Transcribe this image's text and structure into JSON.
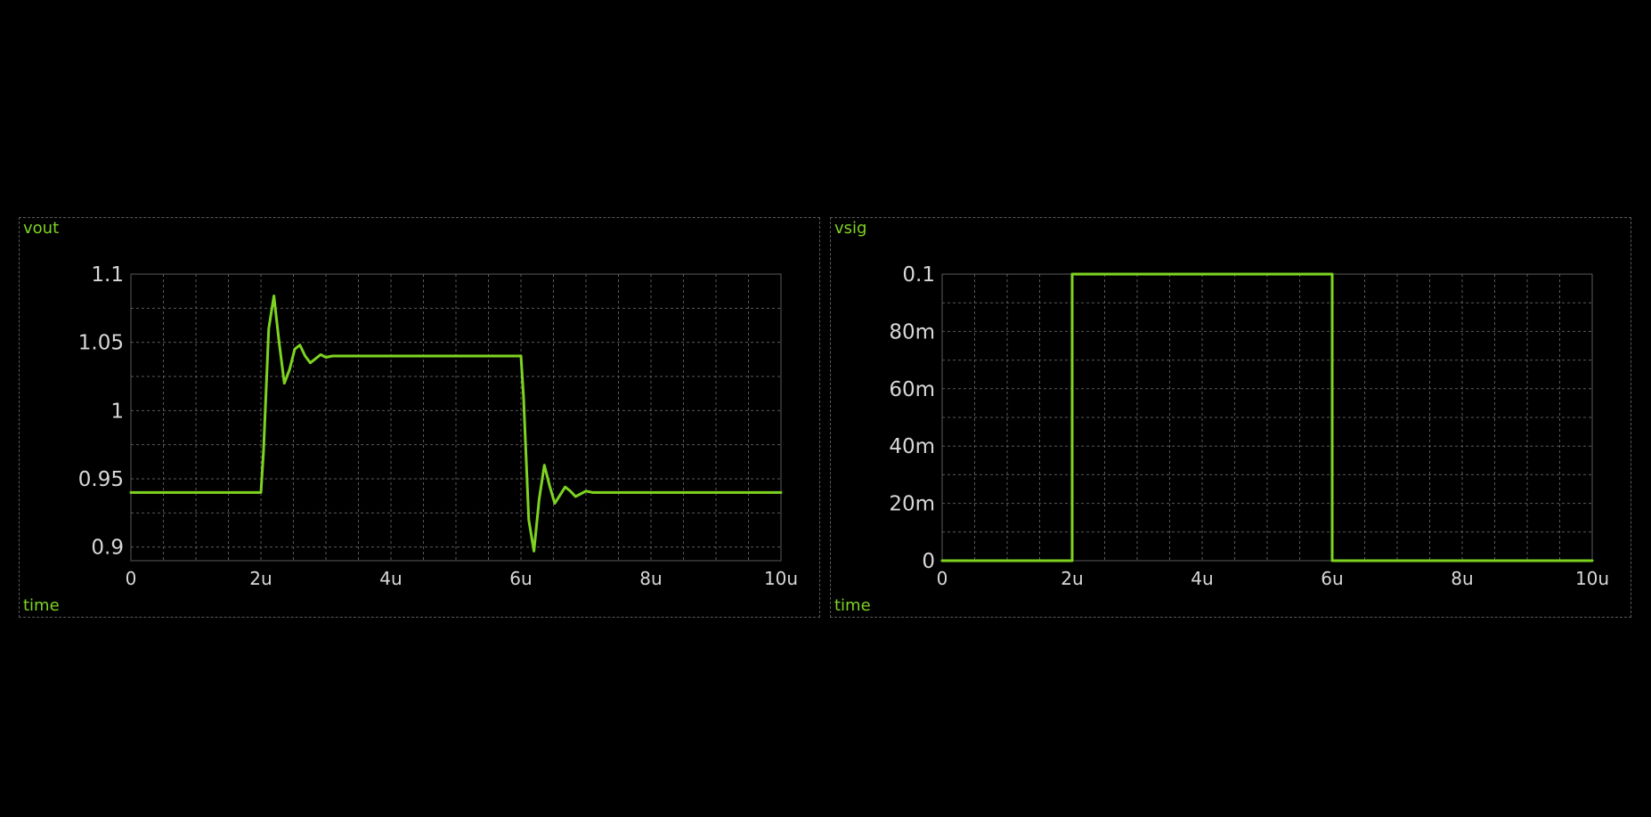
{
  "colors": {
    "background": "#000000",
    "trace": "#7ed321",
    "grid": "#5a5a5a",
    "tick_text": "#d8d8d8"
  },
  "chart_data": [
    {
      "type": "line",
      "signal_label": "vout",
      "xlabel": "time",
      "xlim": [
        0,
        10
      ],
      "ylim": [
        0.89,
        1.1
      ],
      "x_ticks": [
        0,
        2,
        4,
        6,
        8,
        10
      ],
      "x_tick_labels": [
        "0",
        "2u",
        "4u",
        "6u",
        "8u",
        "10u"
      ],
      "y_ticks": [
        0.9,
        0.95,
        1.0,
        1.05,
        1.1
      ],
      "y_tick_labels": [
        "0.9",
        "0.95",
        "1",
        "1.05",
        "1.1"
      ],
      "grid": true,
      "series": [
        {
          "x": [
            0,
            2.0,
            2.04,
            2.12,
            2.2,
            2.28,
            2.36,
            2.44,
            2.52,
            2.6,
            2.68,
            2.76,
            2.84,
            2.92,
            3.0,
            3.1,
            6.0,
            6.04,
            6.12,
            6.2,
            6.28,
            6.36,
            6.44,
            6.52,
            6.6,
            6.68,
            6.76,
            6.84,
            6.92,
            7.0,
            7.1,
            10.0
          ],
          "y": [
            0.94,
            0.94,
            0.97,
            1.06,
            1.084,
            1.05,
            1.02,
            1.03,
            1.045,
            1.048,
            1.04,
            1.035,
            1.038,
            1.041,
            1.039,
            1.04,
            1.04,
            1.01,
            0.92,
            0.897,
            0.935,
            0.96,
            0.945,
            0.932,
            0.938,
            0.944,
            0.941,
            0.937,
            0.939,
            0.941,
            0.94,
            0.94
          ]
        }
      ]
    },
    {
      "type": "line",
      "signal_label": "vsig",
      "xlabel": "time",
      "xlim": [
        0,
        10
      ],
      "ylim": [
        0,
        0.1
      ],
      "x_ticks": [
        0,
        2,
        4,
        6,
        8,
        10
      ],
      "x_tick_labels": [
        "0",
        "2u",
        "4u",
        "6u",
        "8u",
        "10u"
      ],
      "y_ticks": [
        0,
        0.02,
        0.04,
        0.06,
        0.08,
        0.1
      ],
      "y_tick_labels": [
        "0",
        "20m",
        "40m",
        "60m",
        "80m",
        "0.1"
      ],
      "grid": true,
      "series": [
        {
          "x": [
            0,
            2.0,
            2.0,
            6.0,
            6.0,
            10.0
          ],
          "y": [
            0,
            0,
            0.1,
            0.1,
            0,
            0
          ]
        }
      ]
    }
  ]
}
